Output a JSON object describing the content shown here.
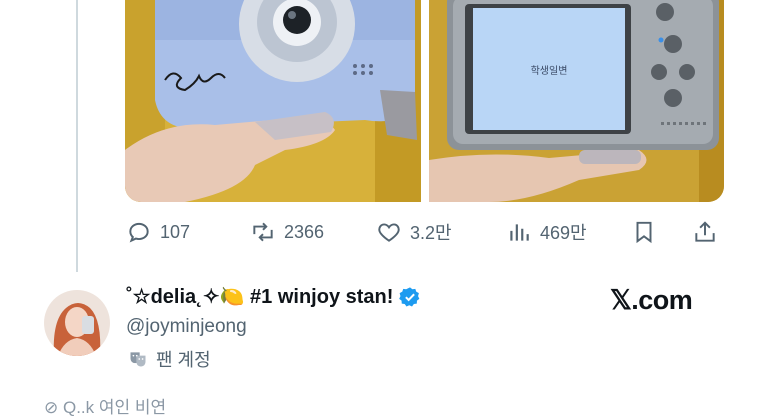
{
  "media": [
    {
      "alt": "blue camera front with signature"
    },
    {
      "alt": "camera back screen",
      "screen_text": "학생일변"
    }
  ],
  "actions": {
    "reply_count": "107",
    "repost_count": "2366",
    "like_count": "3.2만",
    "view_count": "469만"
  },
  "icons": {
    "reply": "reply-icon",
    "repost": "repost-icon",
    "like": "heart-icon",
    "views": "bar-chart-icon",
    "bookmark": "bookmark-icon",
    "share": "share-icon",
    "verified": "verified-badge-icon",
    "label": "theater-masks-icon"
  },
  "profile": {
    "display_name": "˚☆delia˛✧🍋 #1 winjoy stan!",
    "handle": "@joyminjeong",
    "account_label": "팬 계정"
  },
  "brand": "𝕏.com",
  "footer_text": "⊘ Q..k 여인 비연",
  "colors": {
    "verified": "#1d9bf0",
    "muted": "#536471",
    "thread_line": "#cfd9de"
  }
}
